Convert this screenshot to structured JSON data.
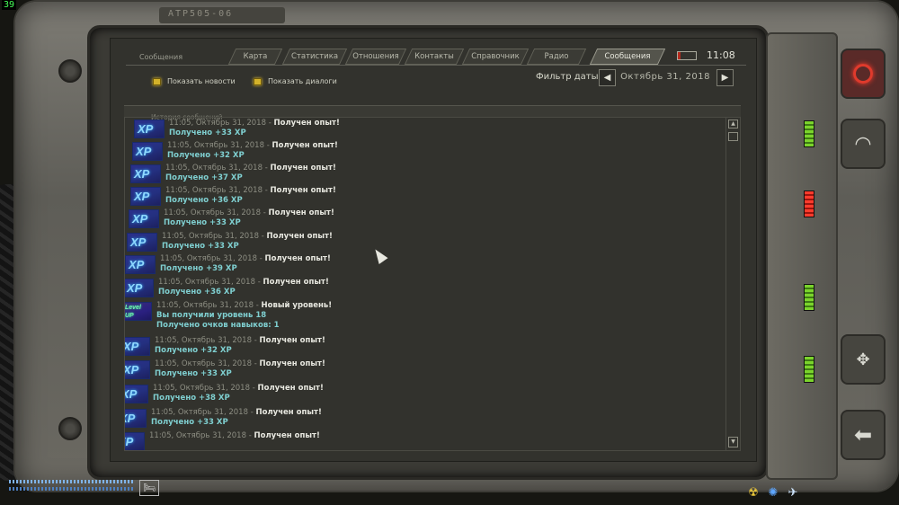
{
  "hud": {
    "fps": "39",
    "bed_icon": "bed-icon",
    "status_icons": [
      "radiation-icon",
      "psy-icon",
      "weight-icon"
    ]
  },
  "pda": {
    "device_label": "ATP505-06",
    "window_title": "Сообщения",
    "tabs": [
      {
        "label": "Карта",
        "active": false
      },
      {
        "label": "Статистика",
        "active": false
      },
      {
        "label": "Отношения",
        "active": false
      },
      {
        "label": "Контакты",
        "active": false
      },
      {
        "label": "Справочник",
        "active": false
      },
      {
        "label": "Радио",
        "active": false
      },
      {
        "label": "Сообщения",
        "active": true
      }
    ],
    "clock": "11:08",
    "battery_level": 0.15,
    "colors": {
      "accent_green": "#7bd42c",
      "accent_red": "#ff3b2c",
      "toggle_yellow": "#d4b22a",
      "message_cyan": "#7fcfd0"
    }
  },
  "filters": {
    "show_news": "Показать новости",
    "show_dialogs": "Показать диалоги",
    "date_filter_label": "Фильтр даты",
    "date_value": "Октябрь 31, 2018",
    "prev_icon": "arrow-left-icon",
    "next_icon": "arrow-right-icon"
  },
  "history": {
    "header": "История сообщений",
    "messages": [
      {
        "badge": "XP",
        "time": "11:05, Октябрь 31, 2018",
        "sep": "-",
        "title": "Получен опыт!",
        "body": "Получено +33 XP"
      },
      {
        "badge": "XP",
        "time": "11:05, Октябрь 31, 2018",
        "sep": "-",
        "title": "Получен опыт!",
        "body": "Получено +32 XP"
      },
      {
        "badge": "XP",
        "time": "11:05, Октябрь 31, 2018",
        "sep": "-",
        "title": "Получен опыт!",
        "body": "Получено +37 XP"
      },
      {
        "badge": "XP",
        "time": "11:05, Октябрь 31, 2018",
        "sep": "-",
        "title": "Получен опыт!",
        "body": "Получено +36 XP"
      },
      {
        "badge": "XP",
        "time": "11:05, Октябрь 31, 2018",
        "sep": "-",
        "title": "Получен опыт!",
        "body": "Получено +33 XP"
      },
      {
        "badge": "XP",
        "time": "11:05, Октябрь 31, 2018",
        "sep": "-",
        "title": "Получен опыт!",
        "body": "Получено +33 XP"
      },
      {
        "badge": "XP",
        "time": "11:05, Октябрь 31, 2018",
        "sep": "-",
        "title": "Получен опыт!",
        "body": "Получено +39 XP"
      },
      {
        "badge": "XP",
        "time": "11:05, Октябрь 31, 2018",
        "sep": "-",
        "title": "Получен опыт!",
        "body": "Получено +36 XP"
      },
      {
        "badge": "Level UP",
        "time": "11:05, Октябрь 31, 2018",
        "sep": "-",
        "title": "Новый уровень!",
        "body": "Вы получили уровень 18",
        "body2": "Получено очков навыков: 1"
      },
      {
        "badge": "XP",
        "time": "11:05, Октябрь 31, 2018",
        "sep": "-",
        "title": "Получен опыт!",
        "body": "Получено +32 XP"
      },
      {
        "badge": "XP",
        "time": "11:05, Октябрь 31, 2018",
        "sep": "-",
        "title": "Получен опыт!",
        "body": "Получено +33 XP"
      },
      {
        "badge": "XP",
        "time": "11:05, Октябрь 31, 2018",
        "sep": "-",
        "title": "Получен опыт!",
        "body": "Получено +38 XP"
      },
      {
        "badge": "XP",
        "time": "11:05, Октябрь 31, 2018",
        "sep": "-",
        "title": "Получен опыт!",
        "body": "Получено +33 XP"
      },
      {
        "badge": "XP",
        "time": "11:05, Октябрь 31, 2018",
        "sep": "-",
        "title": "Получен опыт!",
        "body": ""
      }
    ]
  },
  "side_panel": {
    "power_icon": "power-icon",
    "wifi_icon": "wifi-icon",
    "misc_icon": "crosshair-icon",
    "back_icon": "back-arrow-icon"
  }
}
